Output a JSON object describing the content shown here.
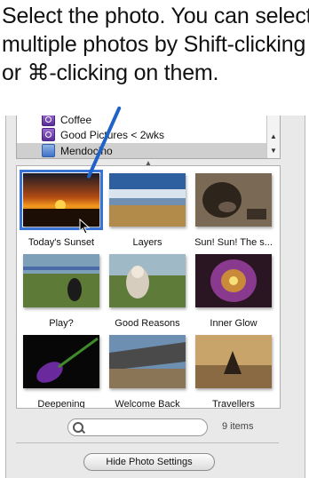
{
  "instruction": {
    "line1": "Select the photo. You can select",
    "line2": "multiple photos by Shift-clicking",
    "line3": "or ⌘-clicking on them."
  },
  "albums": [
    {
      "label": "Coffee",
      "icon": "smart-album-icon"
    },
    {
      "label": "Good Pictures < 2wks",
      "icon": "smart-album-icon"
    },
    {
      "label": "Mendocino",
      "icon": "folder-album-icon",
      "selected": true
    }
  ],
  "photos": [
    {
      "caption": "Today's Sunset",
      "selected": true
    },
    {
      "caption": "Layers"
    },
    {
      "caption": "Sun! Sun! The s..."
    },
    {
      "caption": "Play?"
    },
    {
      "caption": "Good Reasons"
    },
    {
      "caption": "Inner Glow"
    },
    {
      "caption": "Deepening"
    },
    {
      "caption": "Welcome Back"
    },
    {
      "caption": "Travellers"
    }
  ],
  "search": {
    "placeholder": ""
  },
  "item_count": "9 items",
  "hide_settings_label": "Hide Photo Settings",
  "colors": {
    "selection": "#3a73d6",
    "pointer": "#1f63c8"
  }
}
